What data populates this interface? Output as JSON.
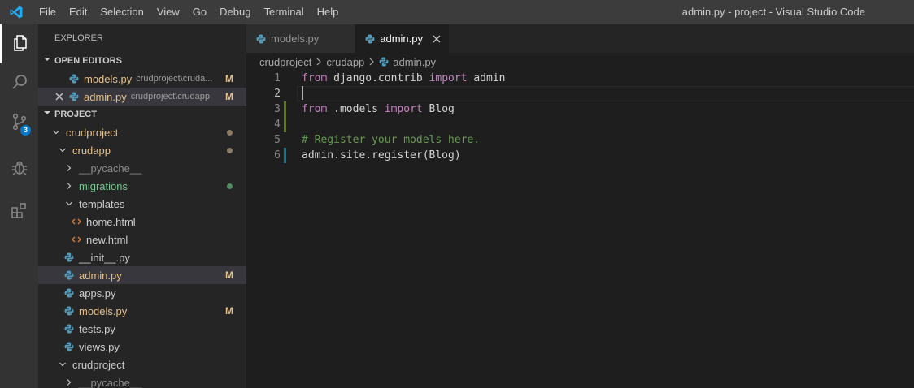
{
  "titlebar": {
    "menu": [
      "File",
      "Edit",
      "Selection",
      "View",
      "Go",
      "Debug",
      "Terminal",
      "Help"
    ],
    "window_title": "admin.py - project - Visual Studio Code"
  },
  "activity": {
    "scm_badge": "3"
  },
  "sidebar": {
    "title": "EXPLORER",
    "open_editors_header": "OPEN EDITORS",
    "open_editors": [
      {
        "name": "models.py",
        "path": "crudproject\\cruda...",
        "status": "M"
      },
      {
        "name": "admin.py",
        "path": "crudproject\\crudapp",
        "status": "M"
      }
    ],
    "project_header": "PROJECT",
    "tree": {
      "crudproject": "crudproject",
      "crudapp": "crudapp",
      "pycache": "__pycache__",
      "migrations": "migrations",
      "templates": "templates",
      "home_html": "home.html",
      "new_html": "new.html",
      "init_py": "__init__.py",
      "admin_py": "admin.py",
      "admin_status": "M",
      "apps_py": "apps.py",
      "models_py": "models.py",
      "models_status": "M",
      "tests_py": "tests.py",
      "views_py": "views.py",
      "crudproject2": "crudproject",
      "pycache2": "__pycache__"
    }
  },
  "tabs": [
    {
      "label": "models.py"
    },
    {
      "label": "admin.py"
    }
  ],
  "breadcrumbs": [
    "crudproject",
    "crudapp",
    "admin.py"
  ],
  "code": {
    "line_numbers": [
      "1",
      "2",
      "3",
      "4",
      "5",
      "6"
    ],
    "l1_kw1": "from",
    "l1_mod": " django.contrib ",
    "l1_kw2": "import",
    "l1_name": " admin",
    "l3_kw1": "from",
    "l3_mod": " .models ",
    "l3_kw2": "import",
    "l3_name": " Blog",
    "l5_comment": "# Register your models here.",
    "l6_text": "admin.site.register(Blog)"
  },
  "colors": {
    "accent": "#007acc",
    "modified": "#e2c08d",
    "untracked": "#73c991",
    "gutter_added": "#587c0c",
    "gutter_modified": "#0c7d9d"
  }
}
